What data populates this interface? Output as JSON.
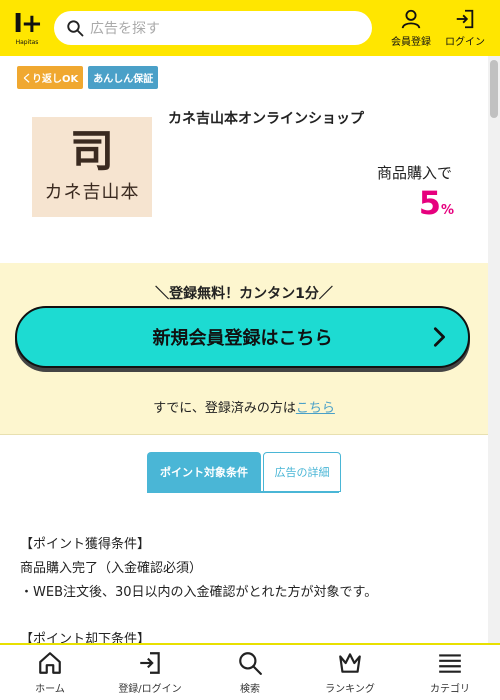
{
  "header": {
    "logo_mark": "I+",
    "logo_text": "Hapitas",
    "search_placeholder": "広告を探す",
    "member_label": "会員登録",
    "login_label": "ログイン"
  },
  "badges": [
    "くり返しOK",
    "あんしん保証"
  ],
  "shop": {
    "logo_mark": "司",
    "logo_script": "カネ吉山本",
    "name": "カネ吉山本オンラインショップ",
    "reward_label": "商品購入で",
    "reward_value": "5",
    "reward_unit": "%"
  },
  "registration": {
    "catch": "＼登録無料！カンタン1分／",
    "button_label": "新規会員登録はこちら",
    "already_text": "すでに、登録済みの方は",
    "login_link": "こちら"
  },
  "tabs": [
    {
      "label": "ポイント対象条件"
    },
    {
      "label": "広告の詳細"
    }
  ],
  "conditions": {
    "heading1": "【ポイント獲得条件】",
    "line1": "商品購入完了（入金確認必須）",
    "line2": "・WEB注文後、30日以内の入金確認がとれた方が対象です。",
    "heading2": "【ポイント却下条件】"
  },
  "bottom_nav": [
    {
      "label": "ホーム",
      "icon": "home-icon"
    },
    {
      "label": "登録/ログイン",
      "icon": "login-icon"
    },
    {
      "label": "検索",
      "icon": "search-icon"
    },
    {
      "label": "ランキング",
      "icon": "crown-icon"
    },
    {
      "label": "カテゴリ",
      "icon": "list-icon"
    }
  ],
  "colors": {
    "brand": "#ffe600",
    "accent": "#1ddbd2",
    "reward": "#e6007e",
    "tab": "#4ab6d6"
  }
}
